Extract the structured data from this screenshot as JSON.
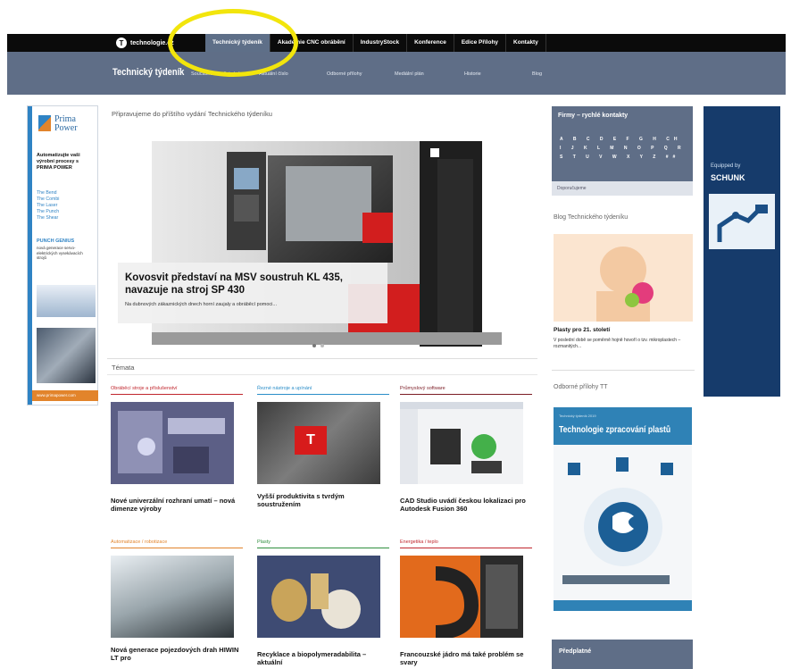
{
  "topbar": {
    "logo_glyph": "T",
    "brand": "technologie.cz",
    "nav": [
      {
        "label": "Technický týdeník",
        "active": true
      },
      {
        "label": "Akademie CNC obrábění",
        "active": false
      },
      {
        "label": "IndustryStock",
        "active": false
      },
      {
        "label": "Konference",
        "active": false
      },
      {
        "label": "Edice Přílohy",
        "active": false
      },
      {
        "label": "Kontakty",
        "active": false
      }
    ]
  },
  "subnav": {
    "title": "Technický týdeník",
    "items": [
      {
        "label": "Současné zaměstnání"
      },
      {
        "label": "Aktuální číslo"
      },
      {
        "label": "Odborné přílohy"
      },
      {
        "label": "Mediální plán"
      },
      {
        "label": "Historie"
      },
      {
        "label": "Blog"
      }
    ]
  },
  "left_ad": {
    "logo_line1": "Prima",
    "logo_line2": "Power",
    "headline": "Automatizujte vaši výrobní procesy s PRIMA POWER",
    "products": [
      "The Bend",
      "The Combi",
      "The Laser",
      "The Punch",
      "The Shear"
    ],
    "punch_title": "PUNCH GENIUS",
    "punch_sub": "nová generace servo-elektrických vysekávacích strojů",
    "url": "www.primapower.com"
  },
  "main": {
    "header": "Připravujeme do příštího vydání Technického týdeníku",
    "hero": {
      "title": "Kovosvit představí na MSV soustruh KL 435, navazuje na stroj SP 430",
      "text": "Na dubnových zákaznických dnech horní zaujaly a obráběcí pomoci..."
    },
    "section_title": "Témata",
    "cards": [
      {
        "category": "Obráběcí stroje a příslušenství",
        "color": "#c0262d",
        "title": "Nové univerzální rozhraní umatí – nová dimenze výroby"
      },
      {
        "category": "Řezné nástroje a upínání",
        "color": "#2a8dc8",
        "title": "Vyšší produktivita s tvrdým soustružením"
      },
      {
        "category": "Průmyslový software",
        "color": "#7b1c25",
        "title": "CAD Studio uvádí českou lokalizaci pro Autodesk Fusion 360"
      },
      {
        "category": "Automatizace / robotizace",
        "color": "#e2842b",
        "title": "Nová generace pojezdových drah HIWIN LT pro"
      },
      {
        "category": "Plasty",
        "color": "#2f8f3e",
        "title": "Recyklace a biopolymeradabilita – aktuální"
      },
      {
        "category": "Energetika / teplo",
        "color": "#c0262d",
        "title": "Francouzské jádro má také problém se svary"
      }
    ],
    "badge": "T"
  },
  "sidebar": {
    "firmy_title": "Firmy – rychlé kontakty",
    "letters": "A B C D E F G H CH I J K L M N O P Q R S T U V W X Y Z ##",
    "firmy_footer": "Doporučujeme",
    "blog_title": "Blog Technického týdeníku",
    "blog_post_title": "Plasty pro 21. století",
    "blog_post_text": "V poslední době se poměrně hojně hovoří o tzv. mikroplastech – rozmanitých...",
    "prilohy_title": "Odborné přílohy TT",
    "magazine_top": "Technický týdeník 2019",
    "magazine_title": "Technologie zpracování plastů",
    "predplatne": "Předplatné"
  },
  "right_ad": {
    "equipped": "Equipped by",
    "brand": "SCHUNK"
  }
}
